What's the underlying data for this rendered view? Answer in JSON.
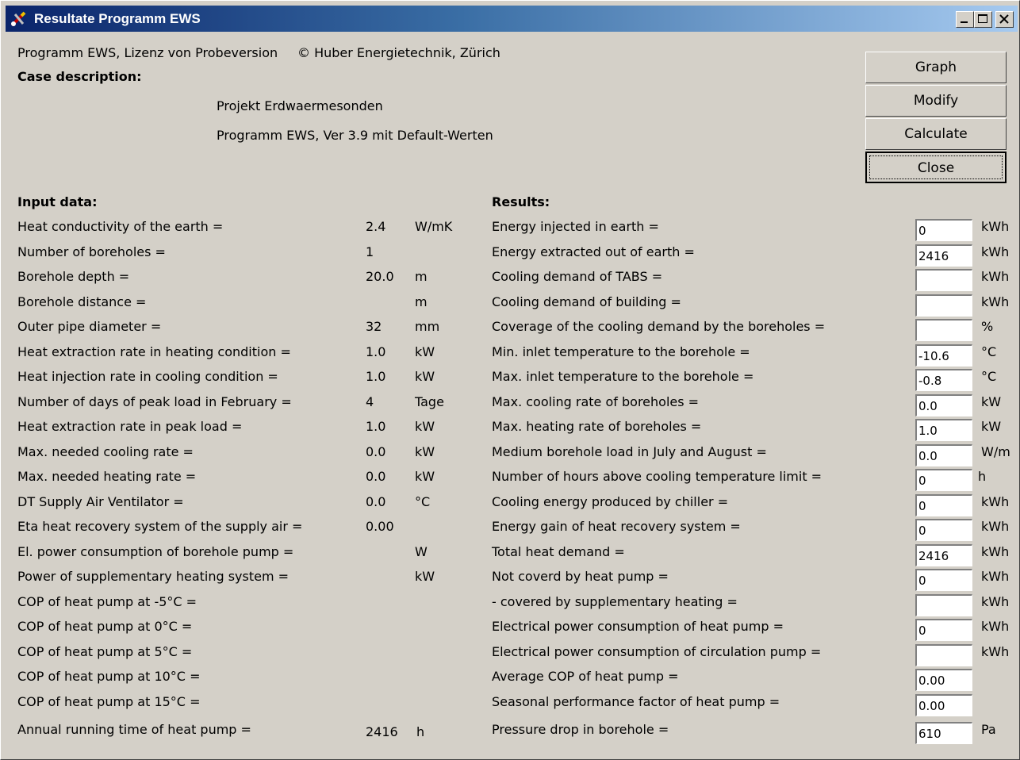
{
  "window": {
    "title": "Resultate Programm EWS",
    "title_icon": "wrench-pencil-icon"
  },
  "header": {
    "program_line": "Programm EWS, Lizenz von Probeversion",
    "copyright": "© Huber Energietechnik, Zürich",
    "case_label": "Case description:",
    "case_line1": "Projekt Erdwaermesonden",
    "case_line2": "Programm EWS, Ver 3.9 mit Default-Werten"
  },
  "buttons": [
    "Graph",
    "Modify",
    "Calculate",
    "Close"
  ],
  "input": {
    "heading": "Input data:",
    "rows": [
      {
        "label": "Heat conductivity of the earth =",
        "value": "2.4",
        "unit": "W/mK"
      },
      {
        "label": "Number of boreholes =",
        "value": "1",
        "unit": ""
      },
      {
        "label": "Borehole depth =",
        "value": "20.0",
        "unit": "m"
      },
      {
        "label": "Borehole distance =",
        "value": "",
        "unit": "m"
      },
      {
        "label": "Outer pipe diameter =",
        "value": "32",
        "unit": "mm"
      },
      {
        "label": "Heat extraction rate in heating condition =",
        "value": "1.0",
        "unit": "kW"
      },
      {
        "label": "Heat injection rate in cooling condition =",
        "value": "1.0",
        "unit": "kW"
      },
      {
        "label": "Number of days of peak load in February =",
        "value": "4",
        "unit": "Tage"
      },
      {
        "label": "Heat extraction rate in peak load =",
        "value": "1.0",
        "unit": "kW"
      },
      {
        "label": "Max. needed cooling rate =",
        "value": "0.0",
        "unit": "kW"
      },
      {
        "label": "Max. needed heating rate =",
        "value": "0.0",
        "unit": "kW"
      },
      {
        "label": "DT Supply Air Ventilator =",
        "value": "0.0",
        "unit": "°C"
      },
      {
        "label": "Eta heat recovery system of the supply air =",
        "value": "0.00",
        "unit": ""
      },
      {
        "label": "El. power consumption of borehole pump =",
        "value": "",
        "unit": "W"
      },
      {
        "label": "Power of supplementary heating system =",
        "value": "",
        "unit": "kW"
      },
      {
        "label": "COP of heat pump at -5°C =",
        "value": "",
        "unit": ""
      },
      {
        "label": "COP of heat pump at 0°C =",
        "value": "",
        "unit": ""
      },
      {
        "label": "COP of heat pump at 5°C =",
        "value": "",
        "unit": ""
      },
      {
        "label": "COP of heat pump at 10°C =",
        "value": "",
        "unit": ""
      },
      {
        "label": "COP of heat pump at 15°C =",
        "value": "",
        "unit": ""
      },
      {
        "label": "Annual running time of heat pump =",
        "value": "2416",
        "unit": "h"
      }
    ]
  },
  "results": {
    "heading": "Results:",
    "rows": [
      {
        "label": "Energy injected in earth =",
        "value": "0",
        "unit": "kWh"
      },
      {
        "label": "Energy extracted out of earth =",
        "value": "2416",
        "unit": "kWh"
      },
      {
        "label": "Cooling demand of TABS =",
        "value": "",
        "unit": "kWh"
      },
      {
        "label": "Cooling demand of building =",
        "value": "",
        "unit": "kWh"
      },
      {
        "label": "Coverage of the cooling demand by the boreholes =",
        "value": "",
        "unit": "%"
      },
      {
        "label": "Min. inlet temperature to the borehole =",
        "value": "-10.6",
        "unit": "°C"
      },
      {
        "label": "Max. inlet temperature to the borehole =",
        "value": "-0.8",
        "unit": "°C"
      },
      {
        "label": "Max. cooling rate of boreholes =",
        "value": "0.0",
        "unit": "kW"
      },
      {
        "label": "Max. heating rate of boreholes =",
        "value": "1.0",
        "unit": "kW"
      },
      {
        "label": "Medium borehole load in July and August =",
        "value": "0.0",
        "unit": "W/m"
      },
      {
        "label": "Number of hours above cooling temperature limit =",
        "value": "0",
        "unit": "h"
      },
      {
        "label": "Cooling energy produced by chiller =",
        "value": "0",
        "unit": "kWh"
      },
      {
        "label": "Energy gain of heat recovery system =",
        "value": "0",
        "unit": "kWh"
      },
      {
        "label": "Total heat demand =",
        "value": "2416",
        "unit": "kWh"
      },
      {
        "label": "Not coverd by heat pump =",
        "value": "0",
        "unit": "kWh"
      },
      {
        "label": "- covered by supplementary heating =",
        "value": "",
        "unit": "kWh"
      },
      {
        "label": "Electrical power consumption of heat pump =",
        "value": "0",
        "unit": "kWh"
      },
      {
        "label": "Electrical power consumption of circulation pump =",
        "value": "",
        "unit": "kWh"
      },
      {
        "label": "Average COP of heat pump =",
        "value": "0.00",
        "unit": ""
      },
      {
        "label": "Seasonal performance factor of heat pump =",
        "value": "0.00",
        "unit": ""
      },
      {
        "label": "Pressure drop in borehole =",
        "value": "610",
        "unit": "Pa"
      }
    ]
  }
}
